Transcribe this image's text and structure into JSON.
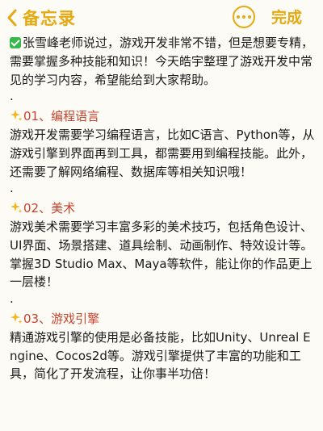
{
  "header": {
    "back_label": "备忘录",
    "done_label": "完成",
    "accent_color": "#e4aa14"
  },
  "note": {
    "intro": "张雪峰老师说过，游戏开发非常不错，但是想要专精，需要掌握多种技能和知识！今天皓宇整理了游戏开发中常见的学习内容，希望能给到大家帮助。",
    "separator": ".",
    "heading_color": "#c7432e",
    "sections": [
      {
        "heading": "01、编程语言",
        "body": "游戏开发需要学习编程语言，比如C语言、Python等，从游戏引擎到界面再到工具，都需要用到编程技能。此外，还需要了解网络编程、数据库等相关知识哦！"
      },
      {
        "heading": "02、美术",
        "body": "游戏美术需要学习丰富多彩的美术技巧，包括角色设计、UI界面、场景搭建、道具绘制、动画制作、特效设计等。掌握3D Studio Max、Maya等软件，能让你的作品更上一层楼！"
      },
      {
        "heading": "03、游戏引擎",
        "body": "精通游戏引擎的使用是必备技能，比如Unity、Unreal Engine、Cocos2d等。游戏引擎提供了丰富的功能和工具，简化了开发流程，让你事半功倍！"
      }
    ]
  }
}
